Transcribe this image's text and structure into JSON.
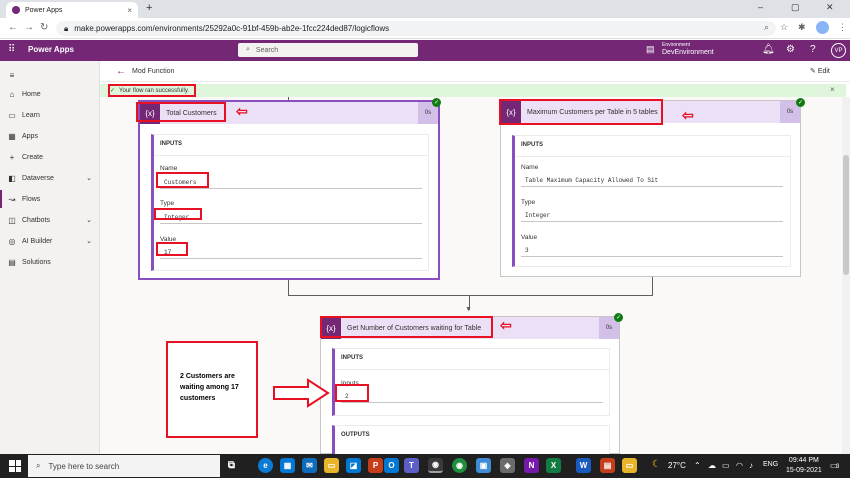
{
  "browser": {
    "tab_title": "Power Apps",
    "tab_close": "×",
    "new_tab": "+",
    "url": "make.powerapps.com/environments/25292a0c-91bf-459b-ab2e-1fcc224ded87/logicflows",
    "win_minimize": "–",
    "win_restore": "▢",
    "win_close": "✕"
  },
  "header": {
    "app_title": "Power Apps",
    "search_placeholder": "Search",
    "environment_label": "Environment",
    "environment_name": "DevEnvironment",
    "user_initials": "VP"
  },
  "sidebar": {
    "items": [
      {
        "label": "Home",
        "icon": "⌂"
      },
      {
        "label": "Learn",
        "icon": "▭"
      },
      {
        "label": "Apps",
        "icon": "▦"
      },
      {
        "label": "Create",
        "icon": "+"
      },
      {
        "label": "Dataverse",
        "icon": "◧",
        "chevron": "⌄"
      },
      {
        "label": "Flows",
        "icon": "↝"
      },
      {
        "label": "Chatbots",
        "icon": "◫",
        "chevron": "⌄"
      },
      {
        "label": "AI Builder",
        "icon": "◎",
        "chevron": "⌄"
      },
      {
        "label": "Solutions",
        "icon": "▤"
      }
    ]
  },
  "commandbar": {
    "flow_name": "Mod Function",
    "edit_label": "Edit"
  },
  "banner": {
    "message": "Your flow ran successfully.",
    "close": "×"
  },
  "cards": {
    "total": {
      "icon": "{x}",
      "title": "Total Customers",
      "time": "0s",
      "inputs_header": "INPUTS",
      "name_label": "Name",
      "name_value": "Customers",
      "type_label": "Type",
      "type_value": "Integer",
      "value_label": "Value",
      "value_value": "17"
    },
    "maximum": {
      "icon": "{x}",
      "title": "Maximum Customers per Table in 5 tables",
      "time": "0s",
      "inputs_header": "INPUTS",
      "name_label": "Name",
      "name_value": "Table Maximum Capacity Allowed To Sit",
      "type_label": "Type",
      "type_value": "Integer",
      "value_label": "Value",
      "value_value": "3"
    },
    "waiting": {
      "icon": "{x}",
      "title": "Get Number of Customers waiting for Table",
      "time": "0s",
      "inputs_header": "INPUTS",
      "inputs_label": "Inputs",
      "inputs_value": "2",
      "outputs_header": "OUTPUTS"
    }
  },
  "annotation": {
    "note": "2 Customers are waiting among 17 customers",
    "arrow": "⇦"
  },
  "taskbar": {
    "search_placeholder": "Type here to search",
    "temperature": "27°C",
    "language": "ENG",
    "time": "09:44 PM",
    "date": "15-09-2021",
    "notification_count": "3"
  },
  "colors": {
    "brand": "#742774",
    "success_bg": "#dff6dd",
    "annotation_red": "#e81123",
    "card_header": "#ebe0f5"
  }
}
